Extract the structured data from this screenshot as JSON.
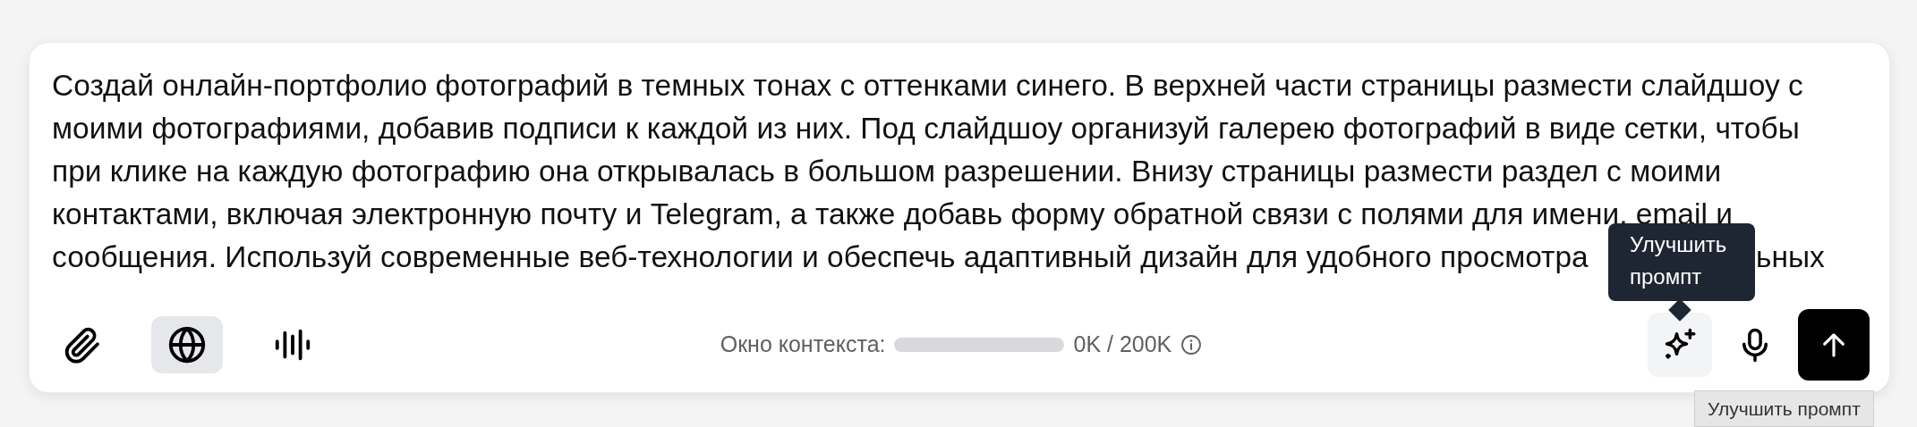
{
  "prompt": {
    "lines": [
      "Создай онлайн-портфолио фотографий в темных тонах с оттенками синего. В верхней части страницы размести слайдшоу с",
      "моими фотографиями, добавив подписи к каждой из них. Под слайдшоу организуй галерею фотографий в виде сетки, чтобы",
      "при клике на каждую фотографию она открывалась в большом разрешении. Внизу страницы размести раздел с моими",
      "контактами, включая электронную почту и Telegram, а также добавь форму обратной связи с полями для имени, email и",
      "сообщения. Используй современные веб-технологии и обеспечь адаптивный дизайн для удобного просмотра"
    ],
    "line_tail": "ьных"
  },
  "left_tools": [
    {
      "kind": "attach",
      "selected": false
    },
    {
      "kind": "web",
      "selected": true
    },
    {
      "kind": "voice",
      "selected": false
    }
  ],
  "context": {
    "label": "Окно контекста:",
    "level": 0,
    "reading": "0K / 200K"
  },
  "right_tools": [
    {
      "kind": "enhance",
      "hovered": true
    },
    {
      "kind": "mic",
      "hovered": false
    },
    {
      "kind": "send",
      "hovered": false
    }
  ],
  "tooltip": {
    "text": "Улучшить промпт"
  },
  "native_tooltip": {
    "text": "Улучшить промпт"
  }
}
